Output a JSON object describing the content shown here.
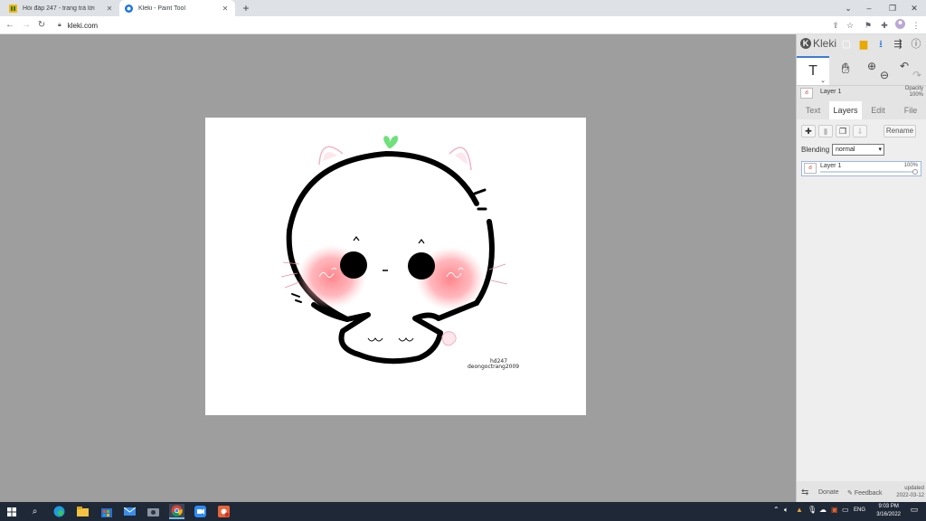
{
  "browser": {
    "tabs": [
      {
        "title": "Hỏi đáp 247 - trang trả lời",
        "favicon": "hoidap-favicon",
        "active": false
      },
      {
        "title": "Kleki - Paint Tool",
        "favicon": "kleki-favicon",
        "active": true
      }
    ],
    "url": "kleki.com"
  },
  "kleki": {
    "brand": "Kleki",
    "layer_header": {
      "name": "Layer 1",
      "opacity_label": "Opacity",
      "opacity_value": "100%"
    },
    "tabs": [
      "Text",
      "Layers",
      "Edit",
      "File"
    ],
    "active_tab": "Layers",
    "layers_panel": {
      "rename_label": "Rename",
      "blending_label": "Blending",
      "blending_value": "normal",
      "layers": [
        {
          "name": "Layer 1",
          "opacity": "100%"
        }
      ]
    },
    "footer": {
      "donate": "Donate",
      "feedback": "Feedback",
      "updated_label": "updated",
      "updated_date": "2022-03-12"
    }
  },
  "drawing": {
    "signature_line1": "hd247",
    "signature_line2": "deongoctrang2009"
  },
  "taskbar": {
    "language": "ENG",
    "time": "9:03 PM",
    "date": "3/16/2022"
  },
  "colors": {
    "workarea_bg": "#9e9e9e",
    "accent": "#3b7dd8",
    "taskbar_bg": "#1f2836"
  }
}
